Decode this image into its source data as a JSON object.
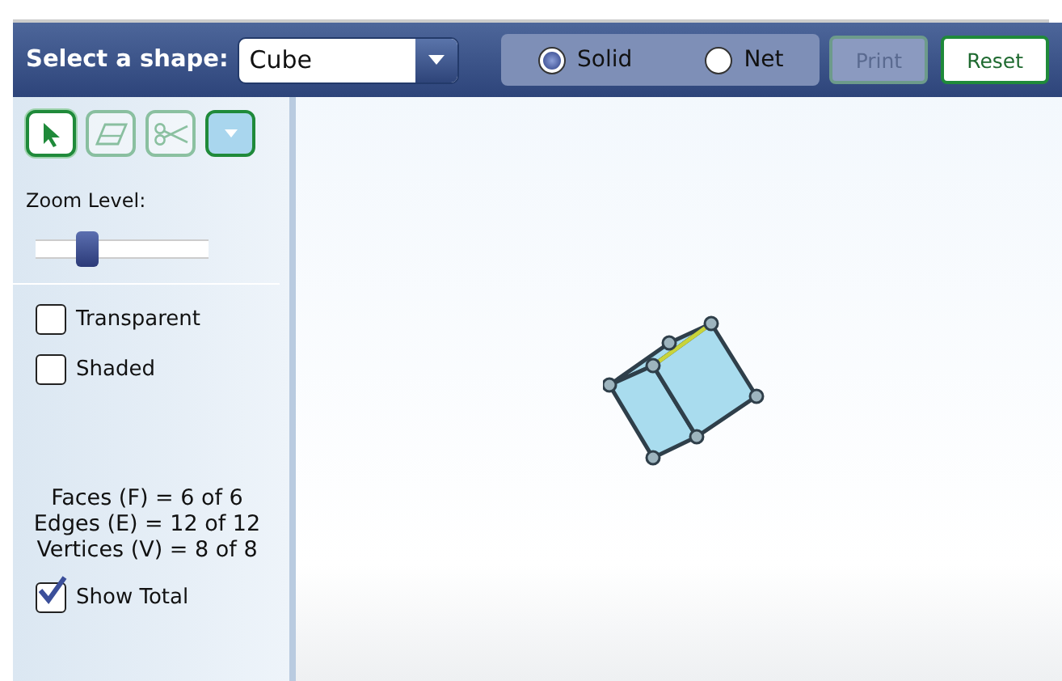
{
  "header": {
    "shape_label": "Select a shape:",
    "shape": "Cube",
    "modes": [
      {
        "label": "Solid",
        "selected": true
      },
      {
        "label": "Net",
        "selected": false
      }
    ],
    "buttons": [
      {
        "label": "Print",
        "disabled": true
      },
      {
        "label": "Reset",
        "disabled": false
      }
    ]
  },
  "sidebar": {
    "tools": [
      {
        "kind": "pointer",
        "selected": true,
        "disabled": false
      },
      {
        "kind": "eraser",
        "selected": false,
        "disabled": true
      },
      {
        "kind": "scissors",
        "selected": false,
        "disabled": true
      },
      {
        "kind": "color",
        "selected": false,
        "disabled": false
      }
    ],
    "zoom": {
      "label": "Zoom Level:",
      "level": 0.3
    },
    "options": [
      {
        "label": "Transparent",
        "checked": false
      },
      {
        "label": "Shaded",
        "checked": false
      }
    ],
    "stats": [
      "Faces (F) = 6 of 6",
      "Edges (E) = 12 of 12",
      "Vertices (V) = 8 of 8"
    ],
    "show_total": {
      "label": "Show Total",
      "checked": true
    }
  }
}
